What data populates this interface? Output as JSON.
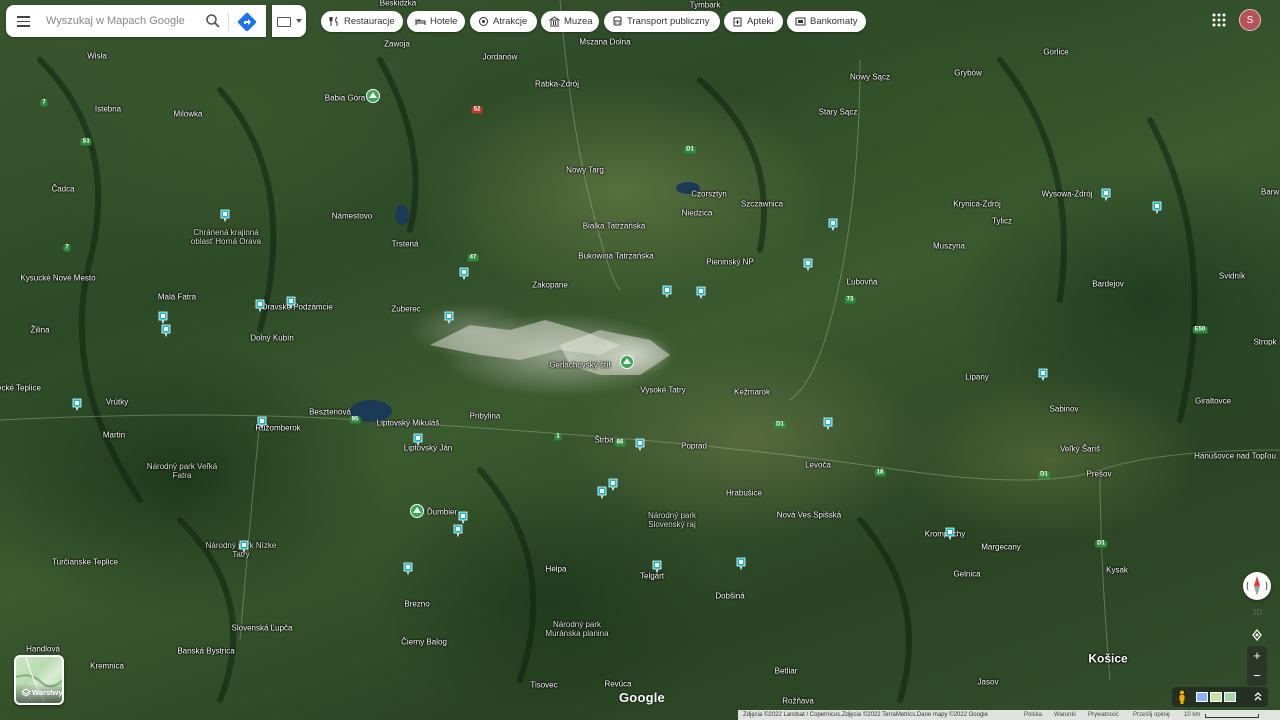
{
  "search": {
    "placeholder": "Wyszukaj w Mapach Google"
  },
  "chips": [
    {
      "label": "Restauracje",
      "icon": "fork-knife-icon"
    },
    {
      "label": "Hotele",
      "icon": "bed-icon"
    },
    {
      "label": "Atrakcje",
      "icon": "camera-icon"
    },
    {
      "label": "Muzea",
      "icon": "museum-icon"
    },
    {
      "label": "Transport publiczny",
      "icon": "bus-icon"
    },
    {
      "label": "Apteki",
      "icon": "pharmacy-icon"
    },
    {
      "label": "Bankomaty",
      "icon": "atm-icon"
    }
  ],
  "account": {
    "initial": "S"
  },
  "layers": {
    "label": "Warstwy"
  },
  "controls": {
    "three_d": "3D",
    "zoom_in": "+",
    "zoom_out": "−"
  },
  "logo": "Google",
  "footer": {
    "attribution": "Zdjęcia ©2022 Landsat / Copernicus,Zdjęcia ©2022 TerraMetrics,Dane mapy ©2022 Google",
    "country": "Polska",
    "terms": "Warunki",
    "privacy": "Prywatność",
    "feedback": "Prześlij opinię",
    "scale": "10 km"
  },
  "places": [
    {
      "name": "Beskidzka",
      "type": "town"
    },
    {
      "name": "Tymbark",
      "type": "town"
    },
    {
      "name": "Zawoja",
      "type": "town"
    },
    {
      "name": "Mszana Dolna",
      "type": "town"
    },
    {
      "name": "Jordanów",
      "type": "town"
    },
    {
      "name": "Wisła",
      "type": "town"
    },
    {
      "name": "Nowy Sącz",
      "type": "town"
    },
    {
      "name": "Gorlice",
      "type": "town"
    },
    {
      "name": "Grybów",
      "type": "town"
    },
    {
      "name": "Rabka-Zdrój",
      "type": "town"
    },
    {
      "name": "Babia Góra",
      "type": "town"
    },
    {
      "name": "Istebna",
      "type": "town"
    },
    {
      "name": "Milówka",
      "type": "town"
    },
    {
      "name": "Stary Sącz",
      "type": "town"
    },
    {
      "name": "Nowy Targ",
      "type": "town"
    },
    {
      "name": "Czorsztyn",
      "type": "town"
    },
    {
      "name": "Szczawnica",
      "type": "town"
    },
    {
      "name": "Krynica-Zdrój",
      "type": "town"
    },
    {
      "name": "Wysowa-Zdrój",
      "type": "town"
    },
    {
      "name": "Barw",
      "type": "town"
    },
    {
      "name": "Čadca",
      "type": "town"
    },
    {
      "name": "Námestovo",
      "type": "town"
    },
    {
      "name": "Chránená krajinná oblasť Horná Orava",
      "type": "park"
    },
    {
      "name": "Bialka Tatrzańska",
      "type": "town"
    },
    {
      "name": "Niedzica",
      "type": "town"
    },
    {
      "name": "Tylicz",
      "type": "town"
    },
    {
      "name": "Trstená",
      "type": "town"
    },
    {
      "name": "Bukowina Tatrzańska",
      "type": "town"
    },
    {
      "name": "Muszyna",
      "type": "town"
    },
    {
      "name": "Kysucké Nové Mesto",
      "type": "town"
    },
    {
      "name": "Pieninský NP",
      "type": "town"
    },
    {
      "name": "Svidník",
      "type": "town"
    },
    {
      "name": "Zakopane",
      "type": "town"
    },
    {
      "name": "Ľubovňa",
      "type": "town"
    },
    {
      "name": "Bardejov",
      "type": "town"
    },
    {
      "name": "Malá Fatra",
      "type": "town"
    },
    {
      "name": "Oravské Podzámcie",
      "type": "town"
    },
    {
      "name": "Zuberec",
      "type": "town"
    },
    {
      "name": "Žilina",
      "type": "town"
    },
    {
      "name": "Dolný Kubín",
      "type": "town"
    },
    {
      "name": "Stropk",
      "type": "town"
    },
    {
      "name": "Gerlachovský štít",
      "type": "town"
    },
    {
      "name": "Vysoké Tatry",
      "type": "town"
    },
    {
      "name": "Lipany",
      "type": "town"
    },
    {
      "name": "Rajecké Teplice",
      "type": "town"
    },
    {
      "name": "Kežmarok",
      "type": "town"
    },
    {
      "name": "Vrútky",
      "type": "town"
    },
    {
      "name": "Besztenová",
      "type": "town"
    },
    {
      "name": "Liptovský Mikuláš",
      "type": "town"
    },
    {
      "name": "Sabinov",
      "type": "town"
    },
    {
      "name": "Giraltovce",
      "type": "town"
    },
    {
      "name": "Ružomberok",
      "type": "town"
    },
    {
      "name": "Pribylina",
      "type": "town"
    },
    {
      "name": "Martin",
      "type": "town"
    },
    {
      "name": "Liptovský Ján",
      "type": "town"
    },
    {
      "name": "Štrba",
      "type": "town"
    },
    {
      "name": "Poprad",
      "type": "town"
    },
    {
      "name": "Veľký Šariš",
      "type": "town"
    },
    {
      "name": "Hanušovce nad Topľou",
      "type": "town"
    },
    {
      "name": "Národný park Veľká Fatra",
      "type": "park"
    },
    {
      "name": "Levoča",
      "type": "town"
    },
    {
      "name": "Prešov",
      "type": "town"
    },
    {
      "name": "Hrabušice",
      "type": "town"
    },
    {
      "name": "Nová Ves Spišská",
      "type": "town"
    },
    {
      "name": "Ďumbier",
      "type": "town"
    },
    {
      "name": "Národný park Slovenský raj",
      "type": "park"
    },
    {
      "name": "Krompachy",
      "type": "town"
    },
    {
      "name": "Margecany",
      "type": "town"
    },
    {
      "name": "Národný park Nízke Tatry",
      "type": "park"
    },
    {
      "name": "Turčianske Teplice",
      "type": "town"
    },
    {
      "name": "Helpa",
      "type": "town"
    },
    {
      "name": "Telgárt",
      "type": "town"
    },
    {
      "name": "Gelnica",
      "type": "town"
    },
    {
      "name": "Kysak",
      "type": "town"
    },
    {
      "name": "Dobšiná",
      "type": "town"
    },
    {
      "name": "Brezno",
      "type": "town"
    },
    {
      "name": "Slovenská Ľupča",
      "type": "town"
    },
    {
      "name": "Národný park Muránska planina",
      "type": "park"
    },
    {
      "name": "Čierny Balog",
      "type": "town"
    },
    {
      "name": "Handlová",
      "type": "town"
    },
    {
      "name": "Banská Bystrica",
      "type": "town"
    },
    {
      "name": "Košice",
      "type": "city"
    },
    {
      "name": "Kremnica",
      "type": "town"
    },
    {
      "name": "Betliar",
      "type": "town"
    },
    {
      "name": "Jasov",
      "type": "town"
    },
    {
      "name": "Tisovec",
      "type": "town"
    },
    {
      "name": "Revúca",
      "type": "town"
    },
    {
      "name": "Rožňava",
      "type": "town"
    }
  ],
  "road_shields": [
    "7",
    "52",
    "S1",
    "7",
    "47",
    "95",
    "1",
    "66",
    "18",
    "D1",
    "D1",
    "D1",
    "D1",
    "73",
    "E50"
  ],
  "accent_color": "#1a73e8",
  "pin_color": "#12b5cb",
  "peak_color": "#3aa757"
}
